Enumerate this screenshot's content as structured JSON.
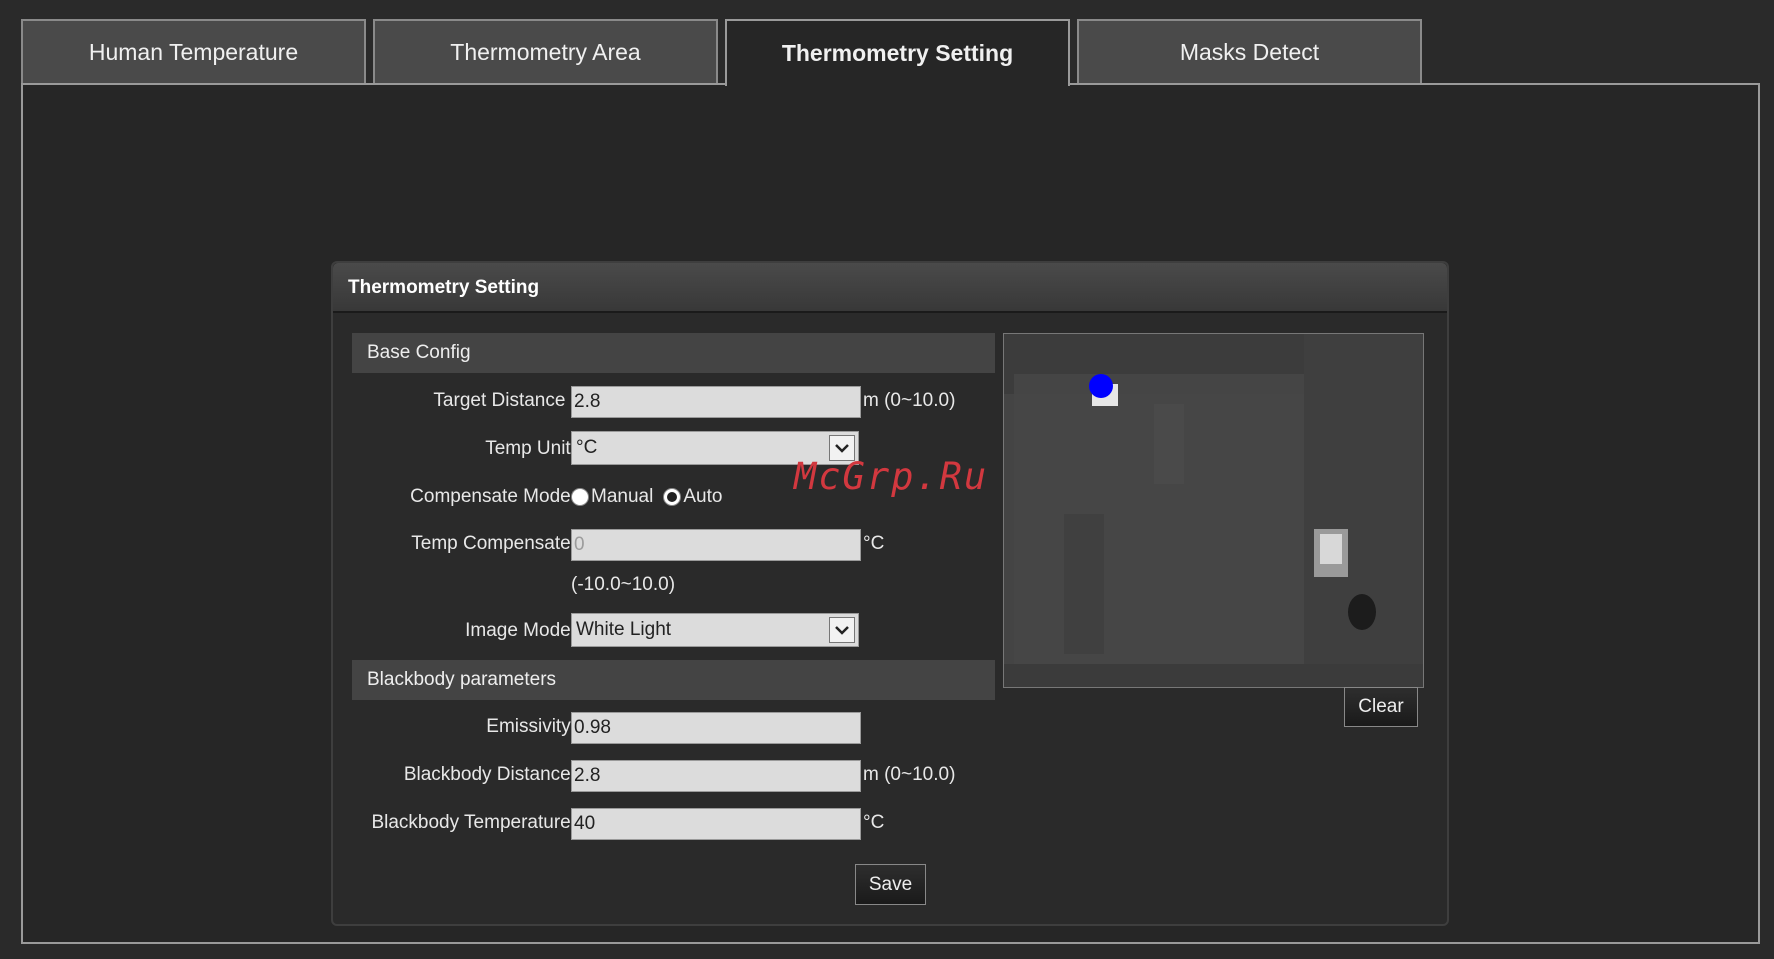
{
  "tabs": [
    {
      "label": "Human Temperature"
    },
    {
      "label": "Thermometry Area"
    },
    {
      "label": "Thermometry Setting"
    },
    {
      "label": "Masks Detect"
    }
  ],
  "panel": {
    "title": "Thermometry Setting"
  },
  "base_config": {
    "heading": "Base Config",
    "target_distance": {
      "label": "Target Distance :",
      "value": "2.8",
      "unit": "m (0~10.0)"
    },
    "temp_unit": {
      "label": "Temp Unit:",
      "selected": "°C"
    },
    "compensate_mode": {
      "label": "Compensate Mode:",
      "options": [
        "Manual",
        "Auto"
      ],
      "selected": "Auto"
    },
    "temp_compensate": {
      "label": "Temp Compensate:",
      "value": "0",
      "unit": "°C",
      "range": "(-10.0~10.0)"
    },
    "image_mode": {
      "label": "Image Mode:",
      "selected": "White Light"
    }
  },
  "blackbody": {
    "heading": "Blackbody parameters",
    "emissivity": {
      "label": "Emissivity:",
      "value": "0.98"
    },
    "distance": {
      "label": "Blackbody Distance:",
      "value": "2.8",
      "unit": "m (0~10.0)"
    },
    "temperature": {
      "label": "Blackbody Temperature:",
      "value": "40",
      "unit": "°C"
    }
  },
  "buttons": {
    "clear": "Clear",
    "save": "Save"
  },
  "watermark": "McGrp.Ru",
  "colors": {
    "marker": "#0000ff",
    "background": "#262626",
    "watermark": "#d2383f"
  }
}
